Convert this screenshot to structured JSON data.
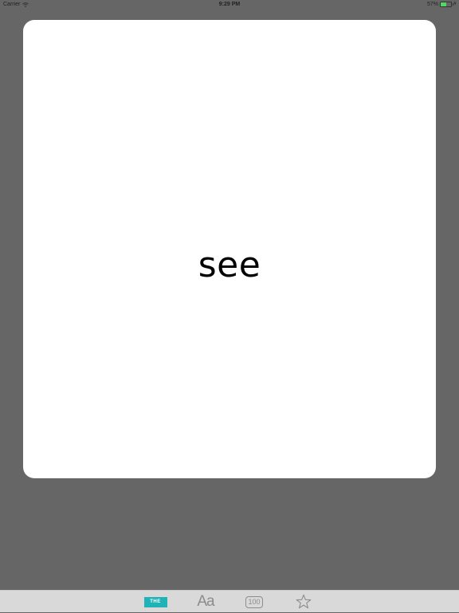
{
  "status_bar": {
    "carrier": "Carrier",
    "time": "9:29 PM",
    "battery_percent": "57%",
    "battery_level": 0.57,
    "wifi_icon": "wifi-icon",
    "charge_icon": "charging-bolt-icon"
  },
  "card": {
    "word": "see"
  },
  "tab_bar": {
    "tabs": [
      {
        "id": "the",
        "label": "THE",
        "icon": "the-badge-icon",
        "selected": true,
        "color": "#1fb3b8"
      },
      {
        "id": "aa",
        "label": "Aa",
        "icon": "font-aa-icon",
        "selected": false
      },
      {
        "id": "100",
        "label": "100",
        "icon": "hundred-icon",
        "selected": false
      },
      {
        "id": "star",
        "label": "",
        "icon": "star-icon",
        "selected": false
      }
    ]
  },
  "colors": {
    "background": "#666666",
    "card": "#ffffff",
    "tab_bar": "#d9d9d9",
    "accent": "#1fb3b8",
    "icon_gray": "#8c8c8c"
  }
}
